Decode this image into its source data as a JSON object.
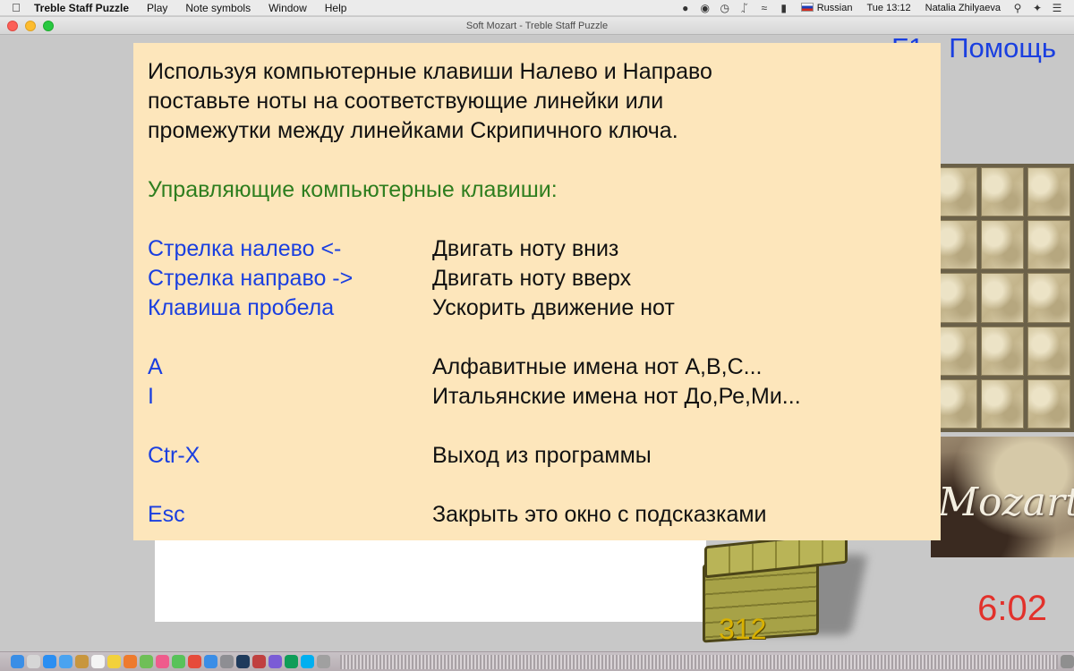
{
  "menubar": {
    "app_name": "Treble Staff Puzzle",
    "menus": [
      "Play",
      "Note symbols",
      "Window",
      "Help"
    ],
    "input_source": "Russian",
    "clock": "Tue 13:12",
    "user": "Natalia Zhilyaeva"
  },
  "window": {
    "title": "Soft Mozart - Treble Staff Puzzle"
  },
  "game": {
    "help_key": "F1",
    "help_label": "Помощь",
    "signature": "Mozart",
    "chest_count": "312",
    "timer": "6:02"
  },
  "help": {
    "intro_lines": [
      "Используя компьютерные клавиши Налево и Направо",
      "поставьте ноты на соответствующие линейки или",
      "промежутки между линейками Скрипичного ключа."
    ],
    "controls_heading": "Управляющие компьютерные клавиши:",
    "keys": [
      {
        "key": "Стрелка налево <-",
        "action": "Двигать ноту вниз"
      },
      {
        "key": "Стрелка направо ->",
        "action": "Двигать ноту вверх"
      },
      {
        "key": "Клавиша пробела",
        "action": "Ускорить движение нот"
      },
      {
        "key": "A",
        "action": "Алфавитные имена нот A,B,C..."
      },
      {
        "key": "I",
        "action": "Итальянские имена нот До,Ре,Ми..."
      },
      {
        "key": "Ctr-X",
        "action": "Выход из программы"
      },
      {
        "key": "Esc",
        "action": "Закрыть это окно с подсказками"
      }
    ]
  },
  "colors": {
    "help_background": "#fde6bb",
    "key_blue": "#1a3fe0",
    "heading_green": "#2e7e1f",
    "timer_red": "#e2312b",
    "chest_gold": "#d9b100"
  }
}
